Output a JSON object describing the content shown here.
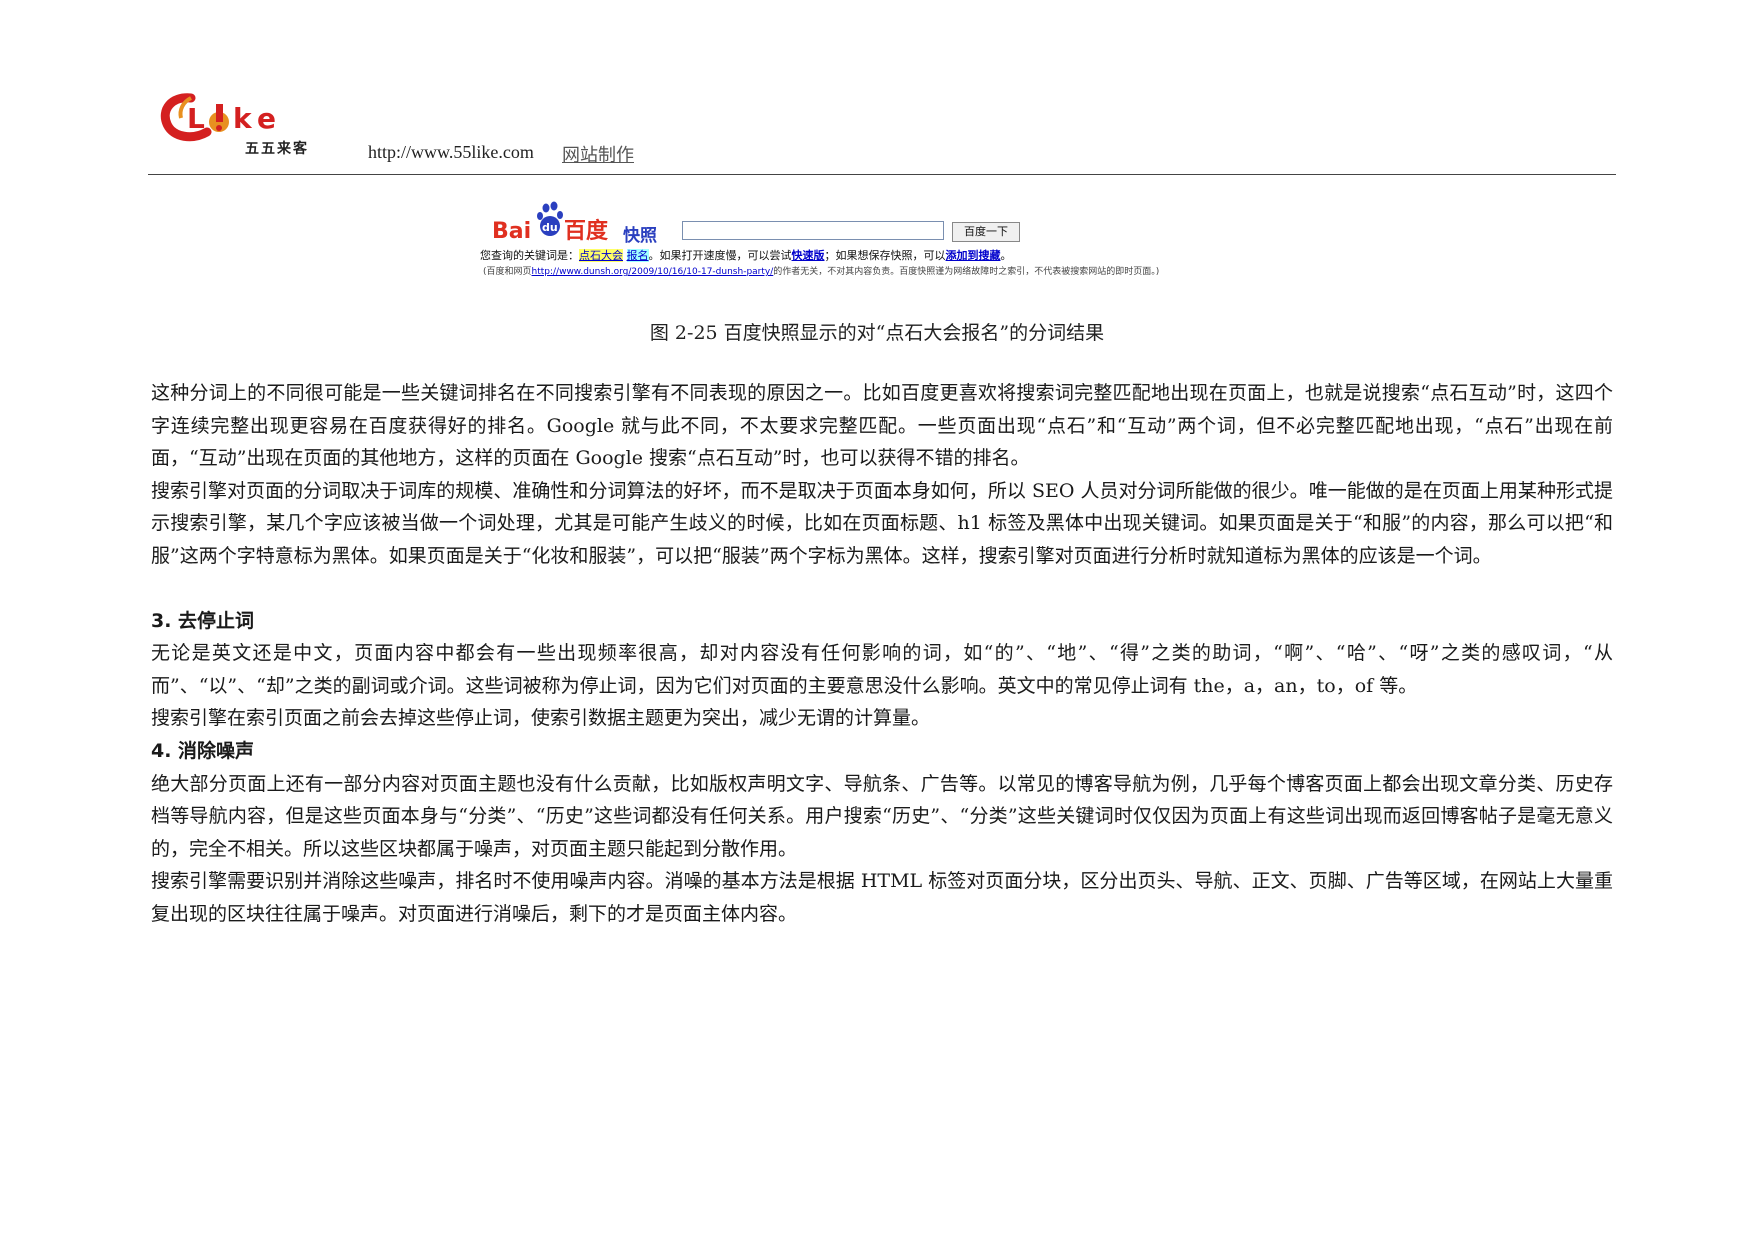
{
  "header": {
    "logo_text": "Like",
    "logo_chinese": "五五来客",
    "url": "http://www.55like.com",
    "link_label": "网站制作",
    "colors": {
      "logo_red": "#d42020",
      "logo_orange": "#e89020"
    }
  },
  "baidu_snapshot": {
    "logo_text": "Bai百度",
    "kuaizhao_label": "快照",
    "search_input_value": "",
    "search_button_label": "百度一下",
    "line1_prefix": "您查询的关键词是：",
    "keyword_1": "点石大会",
    "keyword_2": "报名",
    "line1_mid": "。如果打开速度慢，可以尝试",
    "fast_link": "快速版",
    "line1_mid2": "；如果想保存快照，可以",
    "add_link": "添加到搜藏",
    "line1_end": "。",
    "line2_prefix": "(百度和网页",
    "line2_url": "http://www.dunsh.org/2009/10/16/10-17-dunsh-party/",
    "line2_suffix": "的作者无关，不对其内容负责。百度快照谨为网络故障时之索引，不代表被搜索网站的即时页面。)"
  },
  "caption": "图 2-25 百度快照显示的对“点石大会报名”的分词结果",
  "paragraphs": {
    "p1": "这种分词上的不同很可能是一些关键词排名在不同搜索引擎有不同表现的原因之一。比如百度更喜欢将搜索词完整匹配地出现在页面上，也就是说搜索“点石互动”时，这四个字连续完整出现更容易在百度获得好的排名。Google 就与此不同，不太要求完整匹配。一些页面出现“点石”和“互动”两个词，但不必完整匹配地出现，“点石”出现在前面，“互动”出现在页面的其他地方，这样的页面在 Google 搜索“点石互动”时，也可以获得不错的排名。",
    "p2": "搜索引擎对页面的分词取决于词库的规模、准确性和分词算法的好坏，而不是取决于页面本身如何，所以 SEO 人员对分词所能做的很少。唯一能做的是在页面上用某种形式提示搜索引擎，某几个字应该被当做一个词处理，尤其是可能产生歧义的时候，比如在页面标题、h1 标签及黑体中出现关键词。如果页面是关于“和服”的内容，那么可以把“和服”这两个字特意标为黑体。如果页面是关于“化妆和服装”，可以把“服装”两个字标为黑体。这样，搜索引擎对页面进行分析时就知道标为黑体的应该是一个词。",
    "h3": "3. 去停止词",
    "p3": "无论是英文还是中文，页面内容中都会有一些出现频率很高，却对内容没有任何影响的词，如“的”、“地”、“得”之类的助词，“啊”、“哈”、“呀”之类的感叹词，“从而”、“以”、“却”之类的副词或介词。这些词被称为停止词，因为它们对页面的主要意思没什么影响。英文中的常见停止词有 the，a，an，to，of 等。",
    "p4": "搜索引擎在索引页面之前会去掉这些停止词，使索引数据主题更为突出，减少无谓的计算量。",
    "h4": "4. 消除噪声",
    "p5": "绝大部分页面上还有一部分内容对页面主题也没有什么贡献，比如版权声明文字、导航条、广告等。以常见的博客导航为例，几乎每个博客页面上都会出现文章分类、历史存档等导航内容，但是这些页面本身与“分类”、“历史”这些词都没有任何关系。用户搜索“历史”、“分类”这些关键词时仅仅因为页面上有这些词出现而返回博客帖子是毫无意义的，完全不相关。所以这些区块都属于噪声，对页面主题只能起到分散作用。",
    "p6": "搜索引擎需要识别并消除这些噪声，排名时不使用噪声内容。消噪的基本方法是根据 HTML 标签对页面分块，区分出页头、导航、正文、页脚、广告等区域，在网站上大量重复出现的区块往往属于噪声。对页面进行消噪后，剩下的才是页面主体内容。"
  }
}
